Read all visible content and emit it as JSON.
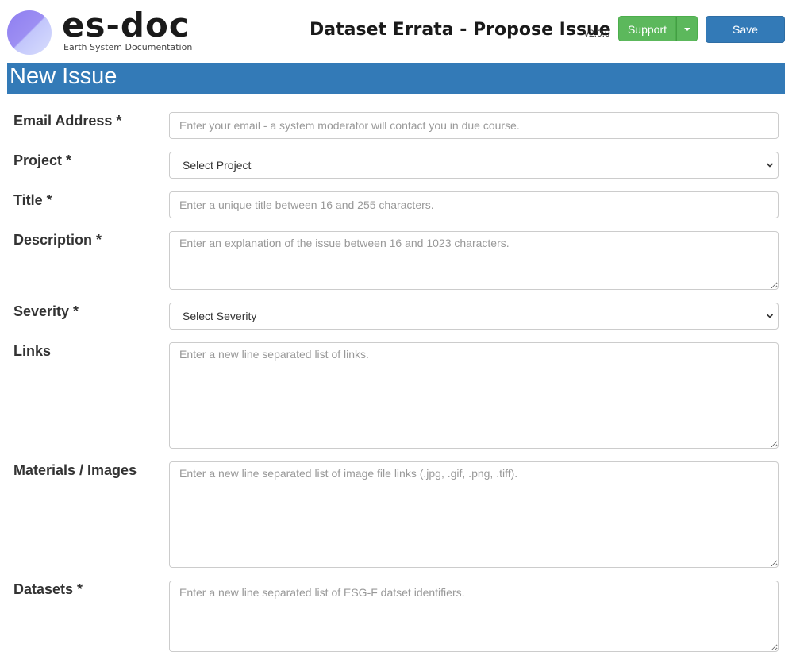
{
  "header": {
    "logo_text": "es-doc",
    "logo_subtitle": "Earth System Documentation",
    "app_title": "Dataset Errata - Propose Issue",
    "version": "v2.0.0",
    "support_label": "Support",
    "save_label": "Save"
  },
  "banner": {
    "title": "New Issue"
  },
  "form": {
    "email": {
      "label": "Email Address *",
      "placeholder": "Enter your email - a system moderator will contact you in due course."
    },
    "project": {
      "label": "Project *",
      "selected": "Select Project"
    },
    "title": {
      "label": "Title *",
      "placeholder": "Enter a unique title between 16 and 255 characters."
    },
    "description": {
      "label": "Description *",
      "placeholder": "Enter an explanation of the issue between 16 and 1023 characters."
    },
    "severity": {
      "label": "Severity *",
      "selected": "Select Severity"
    },
    "links": {
      "label": "Links",
      "placeholder": "Enter a new line separated list of links."
    },
    "materials": {
      "label": "Materials / Images",
      "placeholder": "Enter a new line separated list of image file links (.jpg, .gif, .png, .tiff)."
    },
    "datasets": {
      "label": "Datasets *",
      "placeholder": "Enter a new line separated list of ESG-F datset identifiers."
    }
  },
  "colors": {
    "primary": "#337ab7",
    "success": "#5cb85c",
    "logo_gradient_dark": "#8e7ef0",
    "logo_gradient_light": "#d8ddfd"
  },
  "icons": [
    "logo-icon",
    "caret-down-icon",
    "chevron-down-icon"
  ]
}
